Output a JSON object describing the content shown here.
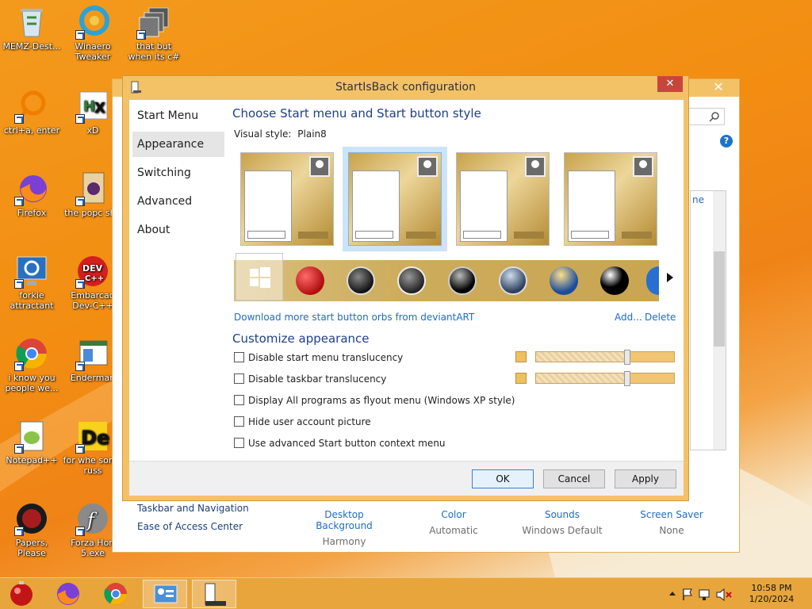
{
  "desktop": {
    "icons": [
      {
        "label": "MEMZ-Dest...",
        "icon": "recycle-bin-icon"
      },
      {
        "label": "Winaero Tweaker",
        "icon": "winaero-tweaker-icon"
      },
      {
        "label": "that but when its c#",
        "icon": "folder-stack-icon"
      },
      {
        "label": "ctrl+a, enter",
        "icon": "magnifier-ring-icon"
      },
      {
        "label": "xD",
        "icon": "hxd-icon"
      },
      {
        "label": "Firefox",
        "icon": "firefox-icon"
      },
      {
        "label": "the popc shit",
        "icon": "media-file-icon"
      },
      {
        "label": "forkie attractant",
        "icon": "monitor-gear-icon"
      },
      {
        "label": "Embarcad Dev-C++",
        "icon": "dev-cpp-icon"
      },
      {
        "label": "i know you people we...",
        "icon": "chrome-icon"
      },
      {
        "label": "Enderman",
        "icon": "window-app-icon"
      },
      {
        "label": "Notepad++",
        "icon": "notepadpp-icon"
      },
      {
        "label": "for whe some russ",
        "icon": "de-logo-icon"
      },
      {
        "label": "Papers, Please",
        "icon": "papers-please-icon"
      },
      {
        "label": "Forza Hori 5.exe",
        "icon": "flash-icon"
      }
    ]
  },
  "background_window": {
    "left_links": [
      "Taskbar and Navigation",
      "Ease of Access Center"
    ],
    "items": [
      {
        "title": "Desktop Background",
        "sub": "Harmony"
      },
      {
        "title": "Color",
        "sub": "Automatic"
      },
      {
        "title": "Sounds",
        "sub": "Windows Default"
      },
      {
        "title": "Screen Saver",
        "sub": "None"
      }
    ],
    "partial_text": "ne"
  },
  "dialog": {
    "title": "StartIsBack configuration",
    "close_glyph": "✕",
    "nav": [
      "Start Menu",
      "Appearance",
      "Switching",
      "Advanced",
      "About"
    ],
    "selected_nav": "Appearance",
    "heading": "Choose Start menu and Start button style",
    "visual_style_label": "Visual style:",
    "visual_style_value": "Plain8",
    "download_link": "Download more start button orbs from deviantART",
    "add_link": "Add...",
    "delete_link": "Delete",
    "customize_heading": "Customize appearance",
    "options": [
      "Disable start menu translucency",
      "Disable taskbar translucency",
      "Display All programs as flyout menu (Windows XP style)",
      "Hide user account picture",
      "Use advanced Start button context menu"
    ],
    "sliders": [
      {
        "swatch_color": "#f0c060",
        "value": 0.66
      },
      {
        "swatch_color": "#f0c060",
        "value": 0.66
      }
    ],
    "buttons": {
      "ok": "OK",
      "cancel": "Cancel",
      "apply": "Apply"
    }
  },
  "taskbar": {
    "time": "10:58 PM",
    "date": "1/20/2024"
  },
  "colors": {
    "accent": "#f3c267",
    "heading": "#1e3f8c",
    "link": "#1e6bc6",
    "close": "#c7463c"
  }
}
